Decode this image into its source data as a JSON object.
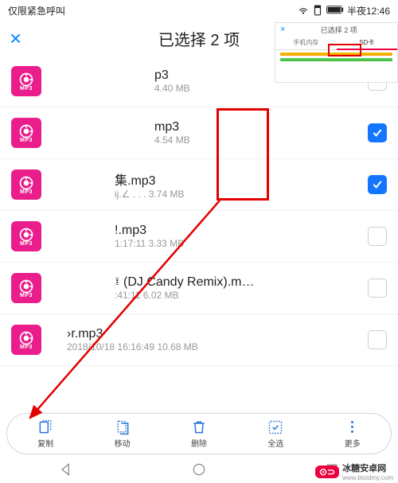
{
  "status_bar": {
    "left": "仅限紧急呼叫",
    "right": "半夜12:46"
  },
  "header": {
    "title": "已选择 2 项",
    "close": "×"
  },
  "inset": {
    "title": "已选择 2 项",
    "tab1": "手机内存",
    "tab2": "SD卡"
  },
  "file_icon_label": "MP3",
  "files": [
    {
      "name": "p3",
      "meta": "4.40 MB",
      "checked": false
    },
    {
      "name": "mp3",
      "meta": "4.54 MB",
      "checked": true
    },
    {
      "name": "集.mp3",
      "meta": "ij.∠ . . . 3.74 MB",
      "checked": true
    },
    {
      "name": "!.mp3",
      "meta": "1:17:11 3.33 MB",
      "checked": false
    },
    {
      "name": "፤ (DJ Candy Remix).m…",
      "meta": ":41:11 6.02 MB",
      "checked": false
    },
    {
      "name": "›r.mp3",
      "meta": "2018/10/18 16:16:49 10.68 MB",
      "checked": false
    }
  ],
  "toolbar": {
    "copy": "复制",
    "move": "移动",
    "delete": "删除",
    "select_all": "全选",
    "more": "更多"
  },
  "brand": {
    "name": "冰糖安卓网",
    "url": "www.btxtdmy.com"
  }
}
